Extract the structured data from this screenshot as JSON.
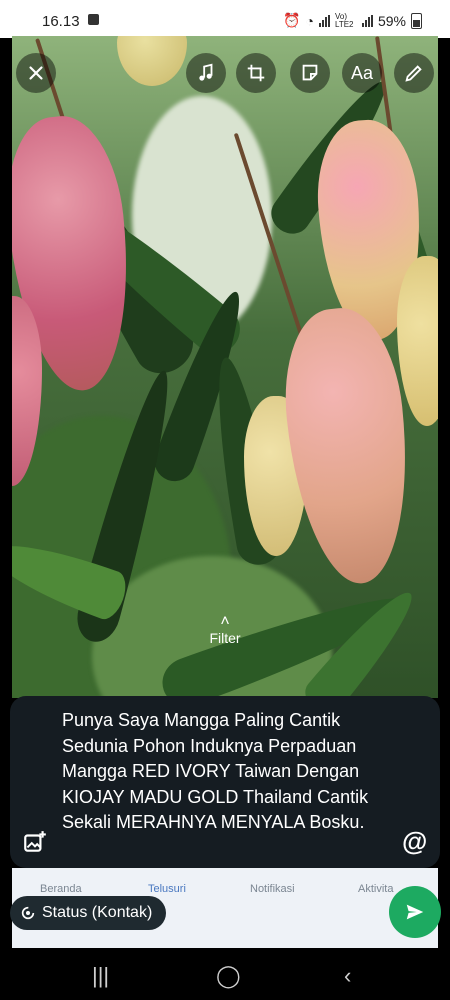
{
  "status_bar": {
    "time": "16.13",
    "network": "Vo) LTE2",
    "battery": "59%"
  },
  "editor_tools": [
    {
      "name": "close-icon"
    },
    {
      "name": "music-icon"
    },
    {
      "name": "crop-rotate-icon"
    },
    {
      "name": "sticker-icon"
    },
    {
      "name": "text-tool",
      "label": "Aa"
    },
    {
      "name": "pencil-icon"
    }
  ],
  "filter_hint": "Filter",
  "caption": "Punya Saya Mangga Paling Cantik Sedunia Pohon Induknya Perpaduan Mangga RED IVORY Taiwan Dengan KIOJAY MADU GOLD Thailand Cantik Sekali MERAHNYA MENYALA Bosku.",
  "background_nav": [
    "Beranda",
    "Telusuri",
    "Notifikasi",
    "Aktivita"
  ],
  "audience_label": "Status (Kontak)",
  "colors": {
    "send_button": "#1daa61",
    "caption_bg": "#151c22"
  }
}
